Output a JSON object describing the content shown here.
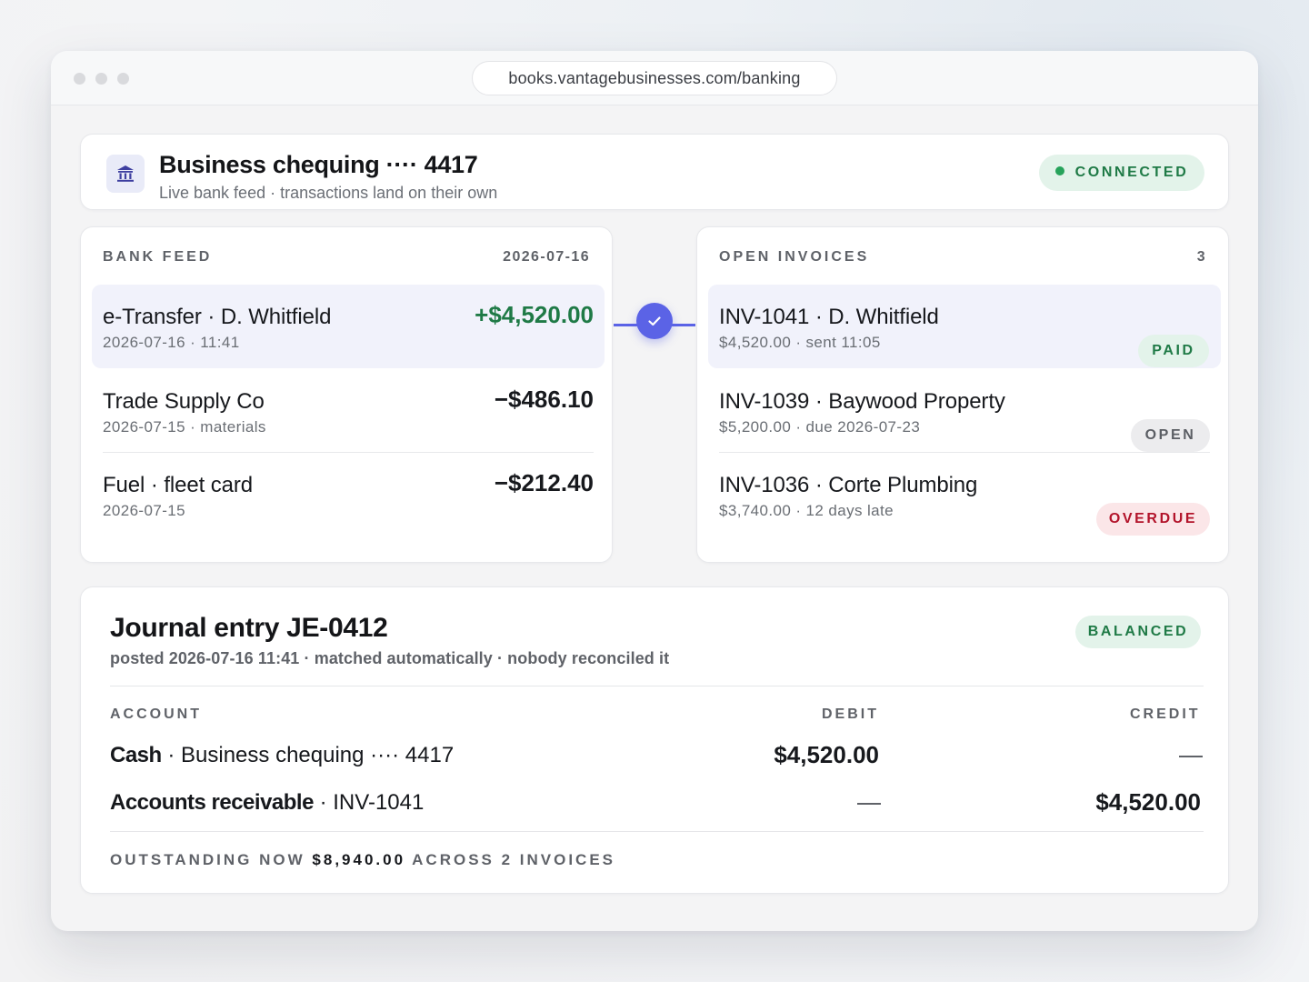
{
  "browser": {
    "url": "books.vantagebusinesses.com/banking"
  },
  "account": {
    "icon": "bank-icon",
    "title": "Business chequing ···· 4417",
    "subtitle": "Live bank feed · transactions land on their own",
    "status": "CONNECTED"
  },
  "bank_feed": {
    "heading": "BANK FEED",
    "date": "2026-07-16",
    "items": [
      {
        "title": "e-Transfer · D. Whitfield",
        "sub": "2026-07-16 · 11:41",
        "amount": "+$4,520.00",
        "matched": true
      },
      {
        "title": "Trade Supply Co",
        "sub": "2026-07-15 · materials",
        "amount": "−$486.10",
        "matched": false
      },
      {
        "title": "Fuel · fleet card",
        "sub": "2026-07-15",
        "amount": "−$212.40",
        "matched": false
      }
    ]
  },
  "match_icon": "check-icon",
  "invoices": {
    "heading": "OPEN INVOICES",
    "count": "3",
    "items": [
      {
        "title": "INV-1041 · D. Whitfield",
        "sub": "$4,520.00 · sent 11:05",
        "status": "PAID"
      },
      {
        "title": "INV-1039 · Baywood Property",
        "sub": "$5,200.00 · due 2026-07-23",
        "status": "OPEN"
      },
      {
        "title": "INV-1036 · Corte Plumbing",
        "sub": "$3,740.00 · 12 days late",
        "status": "OVERDUE"
      }
    ]
  },
  "journal": {
    "title": "Journal entry JE-0412",
    "subtitle": "posted 2026-07-16 11:41 · matched automatically · nobody reconciled it",
    "status": "BALANCED",
    "columns": {
      "account": "ACCOUNT",
      "debit": "DEBIT",
      "credit": "CREDIT"
    },
    "lines": [
      {
        "account": "Cash",
        "detail": " · Business chequing ···· 4417",
        "debit": "$4,520.00",
        "credit": "—"
      },
      {
        "account": "Accounts receivable",
        "detail": " · INV-1041",
        "debit": "—",
        "credit": "$4,520.00"
      }
    ],
    "footer": {
      "prefix": "OUTSTANDING NOW",
      "amount": "$8,940.00",
      "suffix": "ACROSS 2 INVOICES"
    }
  },
  "colors": {
    "accent": "#5b63e6",
    "positive": "#1f7a46",
    "overdue": "#b3142b",
    "highlight": "#f1f2fb"
  }
}
